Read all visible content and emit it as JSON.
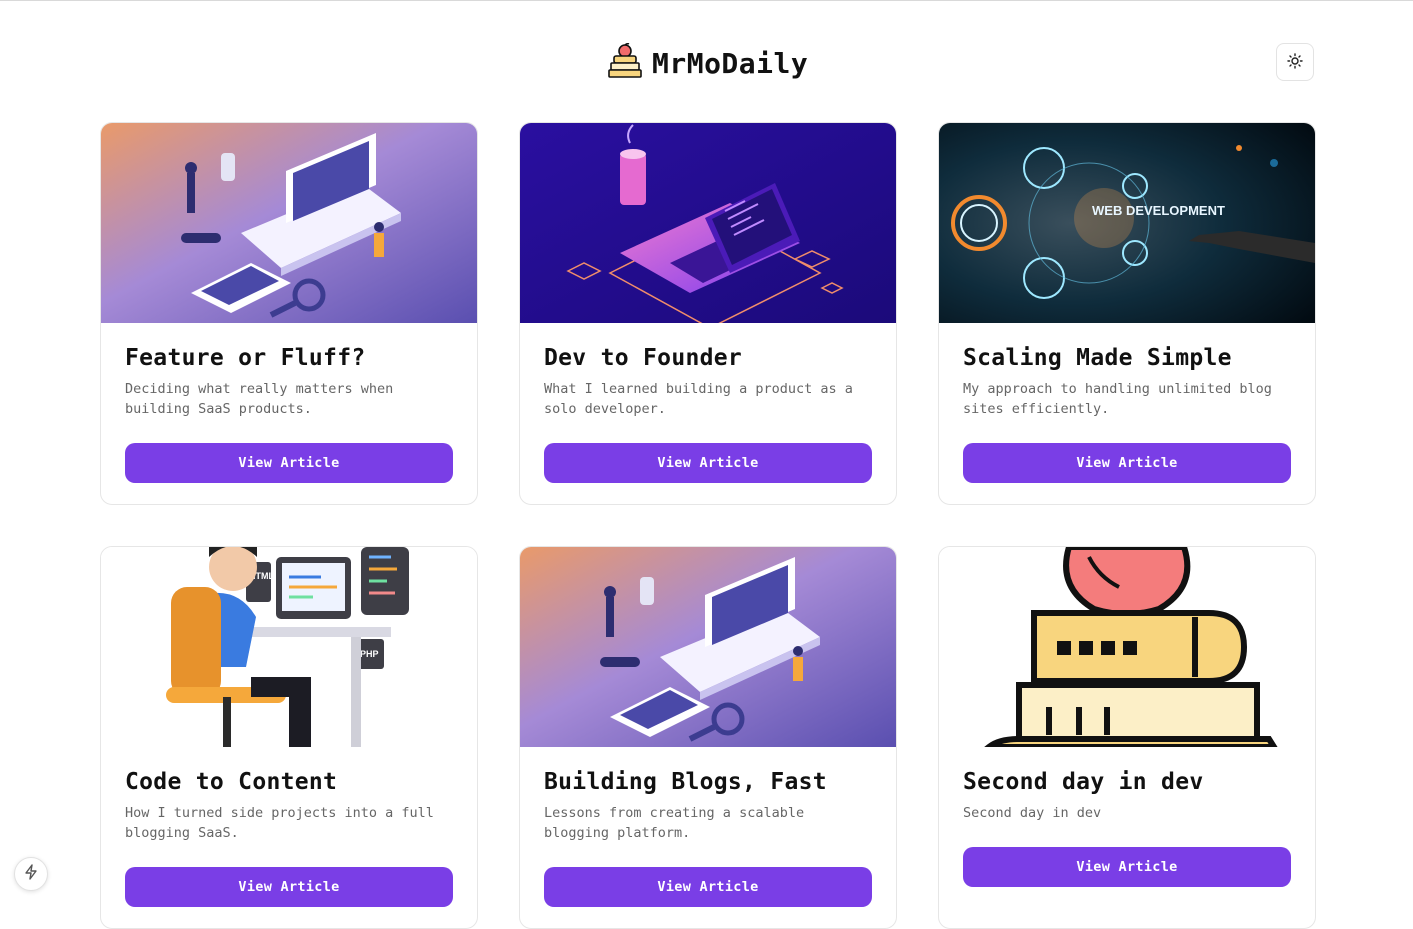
{
  "header": {
    "logo_icon": "stacked-books-apple-icon",
    "title": "MrMoDaily",
    "theme_toggle_icon": "sun-icon"
  },
  "accent_color": "#7a3ee6",
  "articles": [
    {
      "title": "Feature or Fluff?",
      "description": "Deciding what really matters when building SaaS products.",
      "button": "View Article",
      "image": "isometric-laptop-team-illustration"
    },
    {
      "title": "Dev to Founder",
      "description": "What I learned building a product as a solo developer.",
      "button": "View Article",
      "image": "neon-laptop-coffee-illustration"
    },
    {
      "title": "Scaling Made Simple",
      "description": "My approach to handling unlimited blog sites efficiently.",
      "button": "View Article",
      "image": "web-development-hologram-photo",
      "image_text": "WEB DEVELOPMENT"
    },
    {
      "title": "Code to Content",
      "description": "How I turned side projects into a full blogging SaaS.",
      "button": "View Article",
      "image": "developer-at-desk-3d-illustration",
      "image_labels": [
        "HTML",
        "PHP"
      ]
    },
    {
      "title": "Building Blogs, Fast",
      "description": "Lessons from creating a scalable blogging platform.",
      "button": "View Article",
      "image": "isometric-laptop-team-illustration"
    },
    {
      "title": "Second day in dev",
      "description": "Second day in dev",
      "button": "View Article",
      "image": "stacked-books-apple-icon"
    }
  ],
  "floating_button_icon": "lightning-icon"
}
